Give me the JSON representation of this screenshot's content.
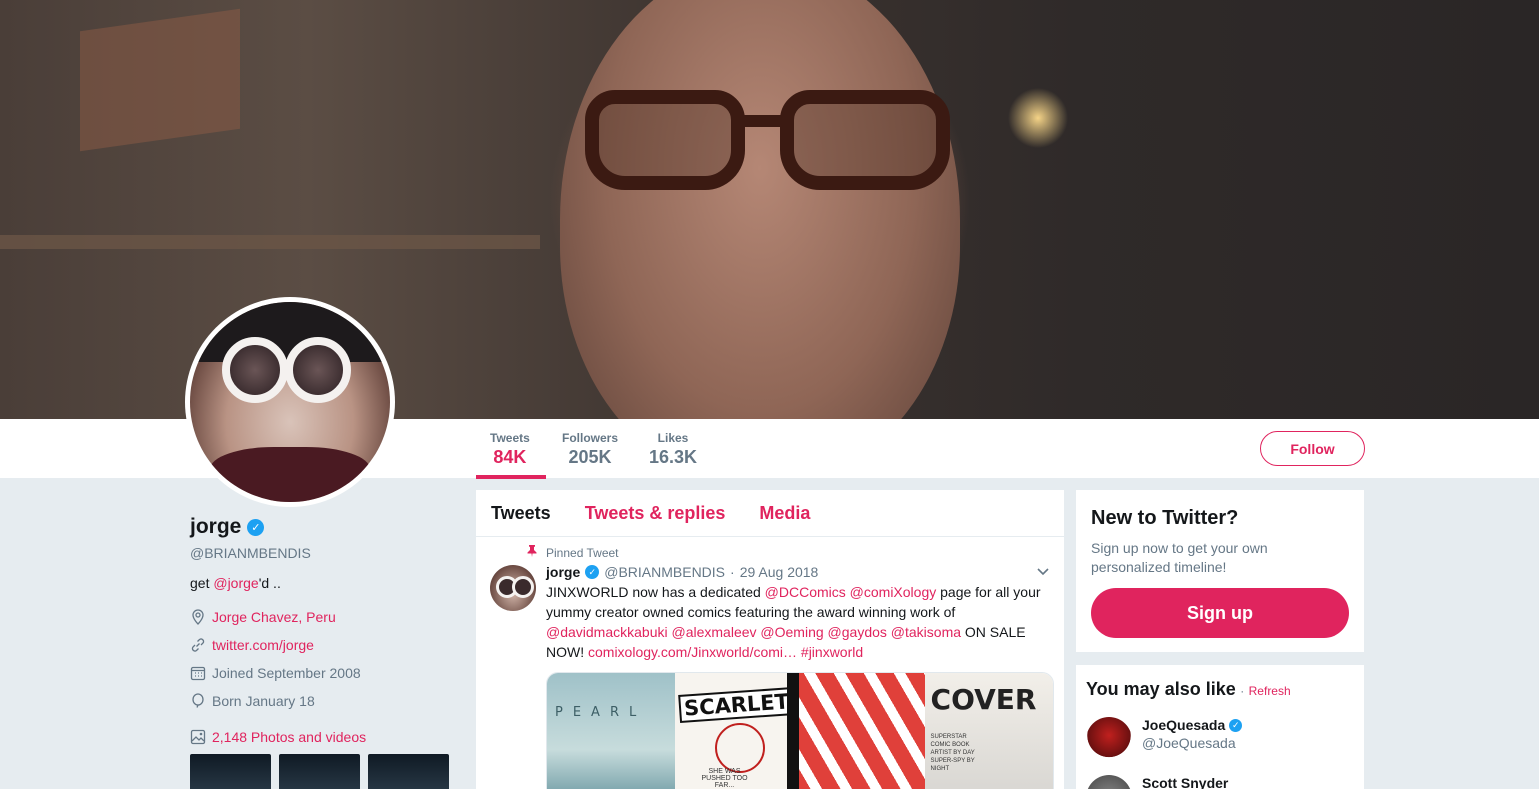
{
  "profile": {
    "name": "jorge",
    "handle": "@BRIANMBENDIS",
    "bio_prefix": "get ",
    "bio_mention": "@jorge",
    "bio_suffix": "'d ..",
    "location": "Jorge Chavez, Peru",
    "website": "twitter.com/jorge",
    "joined": "Joined September 2008",
    "born": "Born January 18",
    "photos": "2,148 Photos and videos"
  },
  "stats": {
    "tweets_label": "Tweets",
    "tweets_value": "84K",
    "followers_label": "Followers",
    "followers_value": "205K",
    "likes_label": "Likes",
    "likes_value": "16.3K"
  },
  "follow_label": "Follow",
  "timeline": {
    "tabs": [
      "Tweets",
      "Tweets & replies",
      "Media"
    ],
    "pinned_label": "Pinned Tweet",
    "tweet": {
      "name": "jorge",
      "handle": "@BRIANMBENDIS",
      "dot": "·",
      "date": "29 Aug 2018",
      "text_1": "JINXWORLD now has a dedicated ",
      "m1": "@DCComics",
      "m2": "@comiXology",
      "text_2": " page for all your yummy creator owned comics featuring the award winning work of ",
      "m3": "@davidmackkabuki",
      "m4": "@alexmaleev",
      "m5": "@Oeming",
      "m6": "@gaydos",
      "m7": "@takisoma",
      "text_3": " ON SALE NOW! ",
      "link": "comixology.com/Jinxworld/comi…",
      "hashtag": "#jinxworld",
      "covers": {
        "pearl": "PEARL",
        "scarlet": "SCARLET",
        "scarlet_sub": "SHE WAS PUSHED TOO FAR...",
        "cover": "COVER",
        "cover_sub": "SUPERSTAR COMIC BOOK ARTIST BY DAY SUPER-SPY BY NIGHT"
      }
    }
  },
  "signup": {
    "title": "New to Twitter?",
    "desc": "Sign up now to get your own personalized timeline!",
    "button": "Sign up"
  },
  "wtf": {
    "title": "You may also like",
    "dot": "·",
    "refresh": "Refresh",
    "users": [
      {
        "name": "JoeQuesada",
        "handle": "@JoeQuesada"
      },
      {
        "name": "Scott Snyder",
        "handle": ""
      }
    ]
  },
  "colors": {
    "accent": "#e0245e",
    "verified": "#1da1f2",
    "muted": "#657786"
  }
}
